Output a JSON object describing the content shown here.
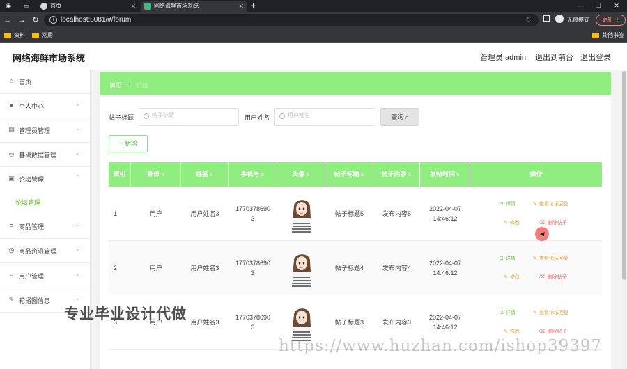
{
  "browser": {
    "tabs": [
      {
        "label": "首页",
        "active": false
      },
      {
        "label": "网络海鲜市场系统",
        "active": true
      }
    ],
    "url": "localhost:8081/#/forum",
    "incognito_label": "无痕模式",
    "update_label": "更新",
    "bookmarks": [
      "资料",
      "常用"
    ],
    "other_bookmarks": "其他书签"
  },
  "header": {
    "title": "网络海鲜市场系统",
    "admin": "管理员 admin",
    "back_front": "退出到前台",
    "logout": "退出登录"
  },
  "sidebar": {
    "items": [
      {
        "label": "首页",
        "icon": "home-icon"
      },
      {
        "label": "个人中心",
        "icon": "user-icon"
      },
      {
        "label": "管理员管理",
        "icon": "admin-icon"
      },
      {
        "label": "基础数据管理",
        "icon": "data-icon"
      },
      {
        "label": "论坛管理",
        "icon": "forum-icon"
      },
      {
        "label": "商品管理",
        "icon": "list-icon"
      },
      {
        "label": "商品资讯管理",
        "icon": "clock-icon"
      },
      {
        "label": "用户管理",
        "icon": "users-icon"
      },
      {
        "label": "轮播图信息",
        "icon": "image-icon"
      }
    ],
    "active_sub": "论坛管理"
  },
  "breadcrumb": {
    "home": "首页",
    "sep": "→",
    "current": "论坛"
  },
  "search": {
    "title_label": "帖子标题",
    "title_placeholder": "帖子标题",
    "user_label": "用户姓名",
    "user_placeholder": "用户姓名",
    "query_label": "查询",
    "add_label": "+ 新增"
  },
  "table": {
    "columns": [
      "索引",
      "身份",
      "姓名",
      "手机号",
      "头像",
      "帖子标题",
      "帖子内容",
      "发帖时间",
      "操作"
    ],
    "rows": [
      {
        "index": "1",
        "role": "用户",
        "name": "用户姓名3",
        "phone": "17703786903",
        "title": "帖子标题5",
        "content": "发布内容5",
        "date": "2022-04-07",
        "time": "14:46:12"
      },
      {
        "index": "2",
        "role": "用户",
        "name": "用户姓名3",
        "phone": "17703786903",
        "title": "帖子标题4",
        "content": "发布内容4",
        "date": "2022-04-07",
        "time": "14:46:12"
      },
      {
        "index": "3",
        "role": "用户",
        "name": "用户姓名3",
        "phone": "17703786903",
        "title": "帖子标题3",
        "content": "发布内容3",
        "date": "2022-04-07",
        "time": "14:46:12"
      }
    ],
    "actions": {
      "detail": "详情",
      "reply": "查看论坛回复",
      "edit": "修改",
      "delete": "删除帖子"
    }
  },
  "watermark": {
    "text": "专业毕业设计代做",
    "url": "https://www.huzhan.com/ishop39397"
  }
}
